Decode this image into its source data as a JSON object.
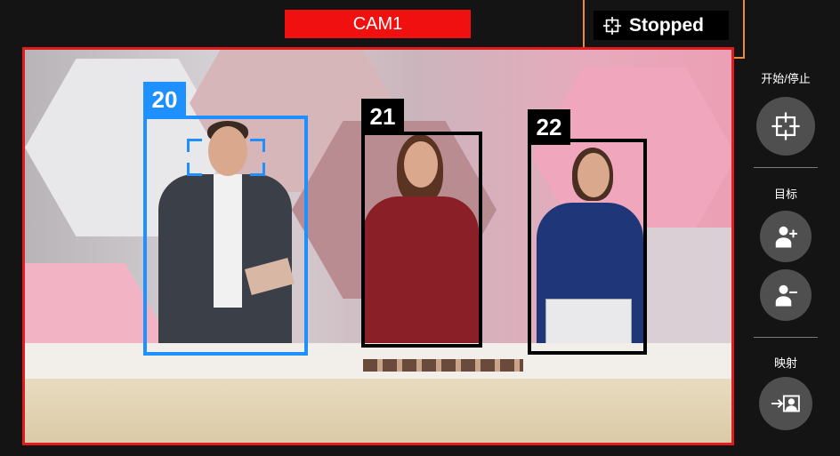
{
  "camera": {
    "label": "CAM1"
  },
  "status": {
    "text": "Stopped",
    "icon": "crosshair-icon"
  },
  "tracking": [
    {
      "id": "20",
      "color": "#1e90ff",
      "focused": true
    },
    {
      "id": "21",
      "color": "#000000",
      "focused": false
    },
    {
      "id": "22",
      "color": "#000000",
      "focused": false
    }
  ],
  "panel": {
    "start_stop_label": "开始/停止",
    "target_label": "目标",
    "mapping_label": "映射"
  },
  "colors": {
    "frame_border": "#e21c1c",
    "status_highlight": "#ef8a3a",
    "button_bg": "#4f4f4f"
  }
}
